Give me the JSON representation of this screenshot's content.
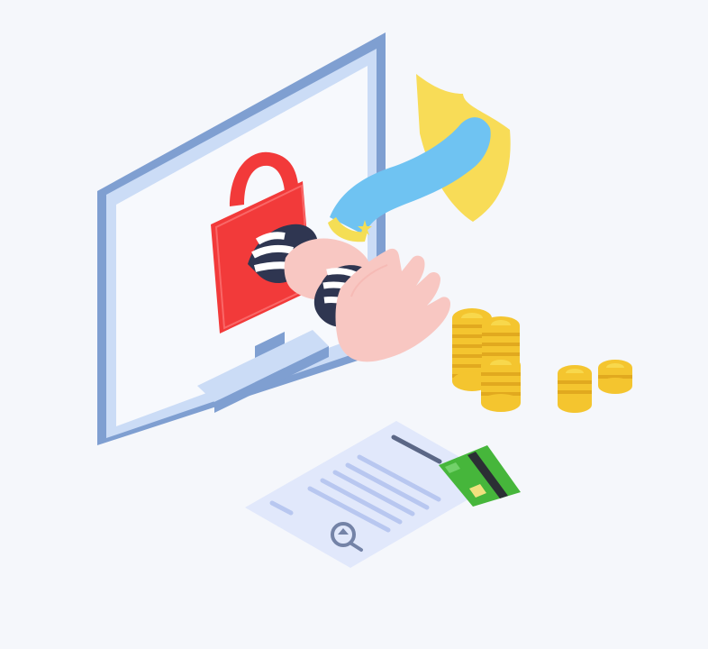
{
  "scene": {
    "background": "#f5f7fb",
    "subject": "cyber-theft-illustration",
    "icons": [
      "computer-monitor-icon",
      "padlock-icon",
      "thief-hand-icon",
      "security-guard-hand-icon",
      "shield-icon",
      "coin-stack-icon",
      "document-icon",
      "magnifier-icon",
      "credit-card-icon"
    ],
    "colors": {
      "monitor_frame": "#7f9fd1",
      "monitor_screen": "#f7f9fd",
      "lock": "#f23a3a",
      "guard_sleeve": "#6fc3f2",
      "guard_cuff": "#f4de55",
      "shield": "#f8dc57",
      "skin": "#f8c7c2",
      "stripe_dark": "#2f3651",
      "stripe_light": "#ffffff",
      "coin": "#f4c52f",
      "coin_edge": "#e1a91f",
      "document": "#e1e8fb",
      "document_lines": "#b8c7f0",
      "card_green": "#46b63b",
      "card_stripe": "#2b2f34"
    }
  }
}
